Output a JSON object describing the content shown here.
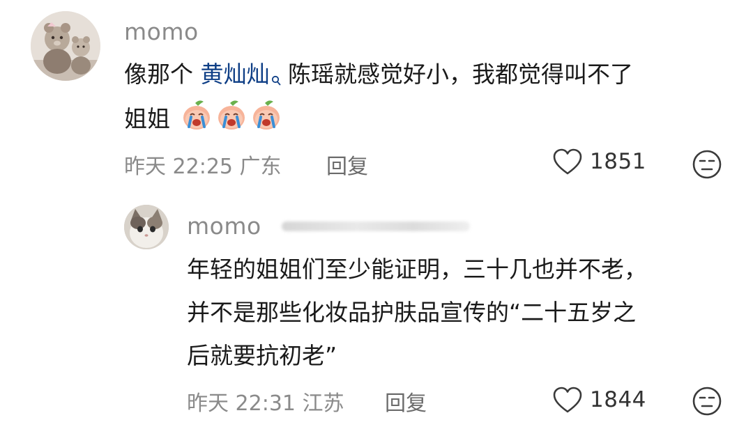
{
  "comments": [
    {
      "username": "momo",
      "text_line1_before": "像那个 ",
      "mention": "黄灿灿",
      "text_line1_after": " 陈瑶就感觉好小，我都觉得叫不了",
      "text_line2": "姐姐",
      "emoji_name": "crying-peach-emoji",
      "time": "昨天 22:25",
      "location": "广东",
      "reply_label": "回复",
      "like_count": "1851"
    },
    {
      "username": "momo",
      "text_line1": "年轻的姐姐们至少能证明，三十几也并不老，",
      "text_line2": "并不是那些化妆品护肤品宣传的“二十五岁之",
      "text_line3": "后就要抗初老”",
      "time": "昨天 22:31",
      "location": "江苏",
      "reply_label": "回复",
      "like_count": "1844"
    }
  ],
  "colors": {
    "mention": "#0f3f86",
    "meta": "#8a8a8a",
    "text": "#1a1a1a"
  }
}
